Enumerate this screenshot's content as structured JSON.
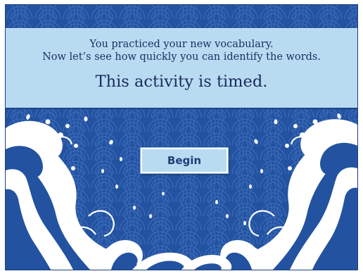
{
  "intro": {
    "line1": "You practiced your new vocabulary.",
    "line2": "Now let’s see how quickly you can identify the words.",
    "timed": "This activity is timed."
  },
  "actions": {
    "begin_label": "Begin"
  },
  "colors": {
    "background": "#2352a0",
    "banner": "#b8dbf2",
    "text": "#1c2f63",
    "wave_foam": "#ffffff"
  }
}
